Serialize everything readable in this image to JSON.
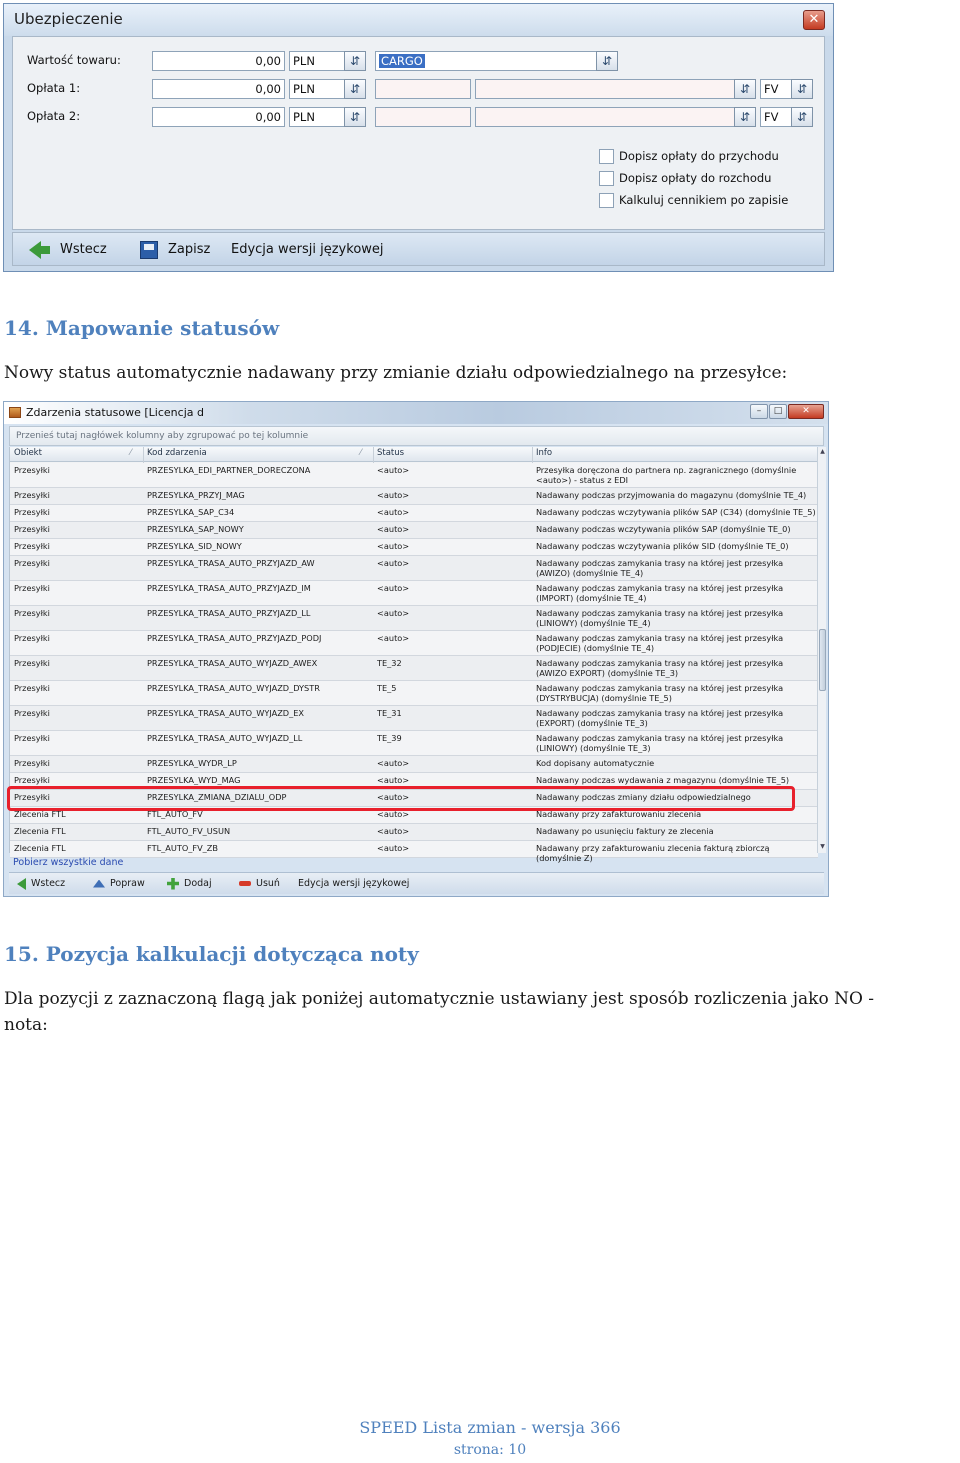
{
  "insurance_window": {
    "title": "Ubezpieczenie",
    "close_glyph": "✕",
    "rows": [
      {
        "label": "Wartość towaru:",
        "amount": "0,00",
        "currency": "PLN",
        "extra": "CARGO"
      },
      {
        "label": "Opłata 1:",
        "amount": "0,00",
        "currency": "PLN",
        "extra": "",
        "doc": "FV"
      },
      {
        "label": "Opłata 2:",
        "amount": "0,00",
        "currency": "PLN",
        "extra": "",
        "doc": "FV"
      }
    ],
    "checkboxes": [
      {
        "label": "Dopisz opłaty do przychodu",
        "checked": false
      },
      {
        "label": "Dopisz opłaty do rozchodu",
        "checked": false
      },
      {
        "label": "Kalkuluj cennikiem po zapisie",
        "checked": false
      }
    ],
    "footer": {
      "back": "Wstecz",
      "save": "Zapisz",
      "lang_edit": "Edycja wersji językowej"
    },
    "icons": {
      "dropdown": "dropdown-arrow-icon",
      "back": "back-arrow-icon",
      "save": "floppy-disk-icon"
    }
  },
  "section14": {
    "heading": "14. Mapowanie statusów",
    "text": "Nowy status automatycznie nadawany przy zmianie działu odpowiedzialnego na przesyłce:"
  },
  "status_window": {
    "title": "Zdarzenia statusowe  [Licencja d",
    "controls": {
      "minimize": "–",
      "maximize": "□",
      "close": "✕"
    },
    "group_hint": "Przenieś tutaj nagłówek kolumny aby zgrupować po tej kolumnie",
    "columns": [
      "Obiekt",
      "Kod zdarzenia",
      "Status",
      "Info"
    ],
    "rows": [
      {
        "obiekt": "Przesyłki",
        "kod": "PRZESYLKA_EDI_PARTNER_DORECZONA",
        "status": "<auto>",
        "info": "Przesyłka doręczona do partnera np. zagranicznego (domyślnie <auto>) - status z EDI",
        "h": 25
      },
      {
        "obiekt": "Przesyłki",
        "kod": "PRZESYLKA_PRZYJ_MAG",
        "status": "<auto>",
        "info": "Nadawany podczas przyjmowania do magazynu (domyślnie TE_4)",
        "h": 17
      },
      {
        "obiekt": "Przesyłki",
        "kod": "PRZESYLKA_SAP_C34",
        "status": "<auto>",
        "info": "Nadawany podczas wczytywania plików SAP (C34) (domyślnie TE_5)",
        "h": 17
      },
      {
        "obiekt": "Przesyłki",
        "kod": "PRZESYLKA_SAP_NOWY",
        "status": "<auto>",
        "info": "Nadawany podczas wczytywania plików SAP (domyślnie TE_0)",
        "h": 17
      },
      {
        "obiekt": "Przesyłki",
        "kod": "PRZESYLKA_SID_NOWY",
        "status": "<auto>",
        "info": "Nadawany podczas wczytywania plików SID (domyślnie TE_0)",
        "h": 17
      },
      {
        "obiekt": "Przesyłki",
        "kod": "PRZESYLKA_TRASA_AUTO_PRZYJAZD_AW",
        "status": "<auto>",
        "info": "Nadawany podczas zamykania trasy na której jest przesyłka (AWIZO) (domyślnie TE_4)",
        "h": 25
      },
      {
        "obiekt": "Przesyłki",
        "kod": "PRZESYLKA_TRASA_AUTO_PRZYJAZD_IM",
        "status": "<auto>",
        "info": "Nadawany podczas zamykania trasy na której jest przesyłka (IMPORT) (domyślnie TE_4)",
        "h": 25
      },
      {
        "obiekt": "Przesyłki",
        "kod": "PRZESYLKA_TRASA_AUTO_PRZYJAZD_LL",
        "status": "<auto>",
        "info": "Nadawany podczas zamykania trasy na której jest przesyłka (LINIOWY) (domyślnie TE_4)",
        "h": 25
      },
      {
        "obiekt": "Przesyłki",
        "kod": "PRZESYLKA_TRASA_AUTO_PRZYJAZD_PODJ",
        "status": "<auto>",
        "info": "Nadawany podczas zamykania trasy na której jest przesyłka (PODJECIE) (domyślnie TE_4)",
        "h": 25
      },
      {
        "obiekt": "Przesyłki",
        "kod": "PRZESYLKA_TRASA_AUTO_WYJAZD_AWEX",
        "status": "TE_32",
        "info": "Nadawany podczas zamykania trasy na której jest przesyłka (AWIZO EXPORT) (domyślnie TE_3)",
        "h": 25
      },
      {
        "obiekt": "Przesyłki",
        "kod": "PRZESYLKA_TRASA_AUTO_WYJAZD_DYSTR",
        "status": "TE_5",
        "info": "Nadawany podczas zamykania trasy na której jest przesyłka (DYSTRYBUCJA) (domyślnie TE_5)",
        "h": 25
      },
      {
        "obiekt": "Przesyłki",
        "kod": "PRZESYLKA_TRASA_AUTO_WYJAZD_EX",
        "status": "TE_31",
        "info": "Nadawany podczas zamykania trasy na której jest przesyłka (EXPORT) (domyślnie TE_3)",
        "h": 25
      },
      {
        "obiekt": "Przesyłki",
        "kod": "PRZESYLKA_TRASA_AUTO_WYJAZD_LL",
        "status": "TE_39",
        "info": "Nadawany podczas zamykania trasy na której jest przesyłka (LINIOWY) (domyślnie TE_3)",
        "h": 25
      },
      {
        "obiekt": "Przesyłki",
        "kod": "PRZESYLKA_WYDR_LP",
        "status": "<auto>",
        "info": "Kod dopisany automatycznie",
        "h": 17
      },
      {
        "obiekt": "Przesyłki",
        "kod": "PRZESYLKA_WYD_MAG",
        "status": "<auto>",
        "info": "Nadawany podczas wydawania z magazynu (domyślnie TE_5)",
        "h": 17
      },
      {
        "obiekt": "Przesyłki",
        "kod": "PRZESYLKA_ZMIANA_DZIALU_ODP",
        "status": "<auto>",
        "info": "Nadawany podczas zmiany działu odpowiedzialnego",
        "h": 17
      },
      {
        "obiekt": "Zlecenia FTL",
        "kod": "FTL_AUTO_FV",
        "status": "<auto>",
        "info": "Nadawany przy zafakturowaniu zlecenia",
        "h": 17
      },
      {
        "obiekt": "Zlecenia FTL",
        "kod": "FTL_AUTO_FV_USUN",
        "status": "<auto>",
        "info": "Nadawany po usunięciu faktury ze zlecenia",
        "h": 17
      },
      {
        "obiekt": "Zlecenia FTL",
        "kod": "FTL_AUTO_FV_ZB",
        "status": "<auto>",
        "info": "Nadawany przy zafakturowaniu zlecenia fakturą zbiorczą (domyślnie Z)",
        "h": 17
      }
    ],
    "highlighted_row": "PRZESYLKA_ZMIANA_DZIALU_ODP",
    "load_all": "Pobierz wszystkie dane",
    "footer": {
      "back": "Wstecz",
      "edit": "Popraw",
      "add": "Dodaj",
      "delete": "Usuń",
      "lang_edit": "Edycja wersji językowej"
    },
    "highlight_color": "#e8202c"
  },
  "section15": {
    "heading": "15. Pozycja kalkulacji dotycząca noty",
    "text_line1": "Dla pozycji z zaznaczoną flagą jak poniżej automatycznie ustawiany jest sposób rozliczenia jako NO -",
    "text_line2": "nota:"
  },
  "page_footer": {
    "line1": "SPEED Lista zmian - wersja 366",
    "line2": "strona: 10"
  },
  "colors": {
    "heading": "#4f81bd",
    "window_frame": "#6f8fb5"
  }
}
